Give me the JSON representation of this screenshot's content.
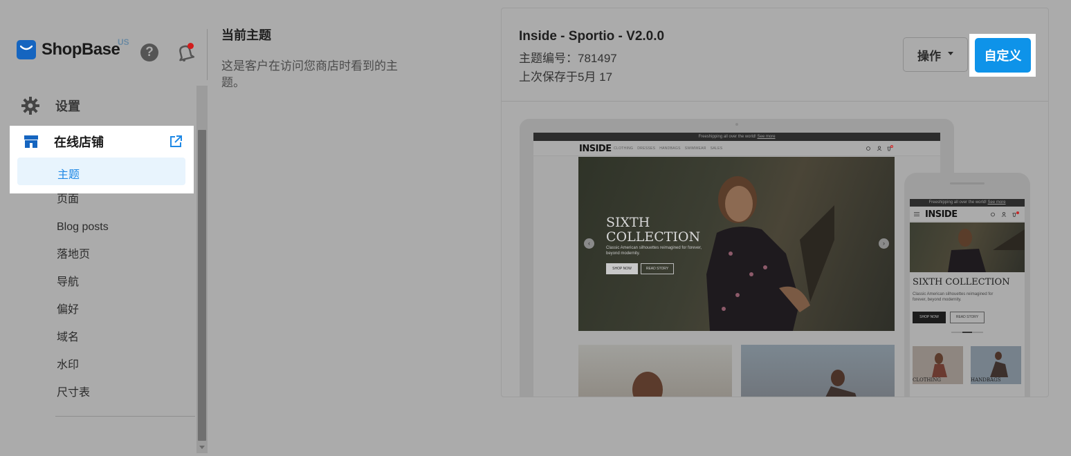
{
  "brand": {
    "name": "ShopBase",
    "region": "US"
  },
  "header_icons": {
    "help": "?"
  },
  "sidebar": {
    "settings_label": "设置",
    "store_label": "在线店铺",
    "active_item": "主题",
    "items": [
      "页面",
      "Blog posts",
      "落地页",
      "导航",
      "偏好",
      "域名",
      "水印",
      "尺寸表"
    ]
  },
  "section": {
    "title": "当前主题",
    "description": "这是客户在访问您商店时看到的主题。"
  },
  "theme": {
    "name": "Inside - Sportio - V2.0.0",
    "id_label": "主题编号：",
    "id_value": "781497",
    "saved": "上次保存于5月 17",
    "actions_label": "操作",
    "customize_label": "自定义"
  },
  "preview": {
    "promo_text": "Freeshipping all over the world!",
    "promo_link": "See more",
    "store_brand": "INSIDE",
    "menu": [
      "CLOTHING",
      "DRESSES",
      "HANDBAGS",
      "SWIMWEAR",
      "SALES"
    ],
    "cart_count": "0",
    "hero_title_line1": "SIXTH",
    "hero_title_line2": "COLLECTION",
    "hero_title_mobile": "SIXTH COLLECTION",
    "hero_subtitle": "Classic American silhouettes reimagined for forever, beyond modernity.",
    "shop_now": "SHOP NOW",
    "read_story": "READ STORY",
    "tile_labels": [
      "CLOTHING",
      "HANDBAGS"
    ]
  },
  "colors": {
    "overlay": "#ababab",
    "primary": "#0e93e9",
    "active_text": "#1e88e5",
    "active_bg": "#e8f4fd",
    "notification": "#d21c1c"
  },
  "icons": [
    "shop-bag-icon",
    "help-icon",
    "bell-icon",
    "gear-icon",
    "store-icon",
    "external-link-icon",
    "caret-down-icon"
  ]
}
